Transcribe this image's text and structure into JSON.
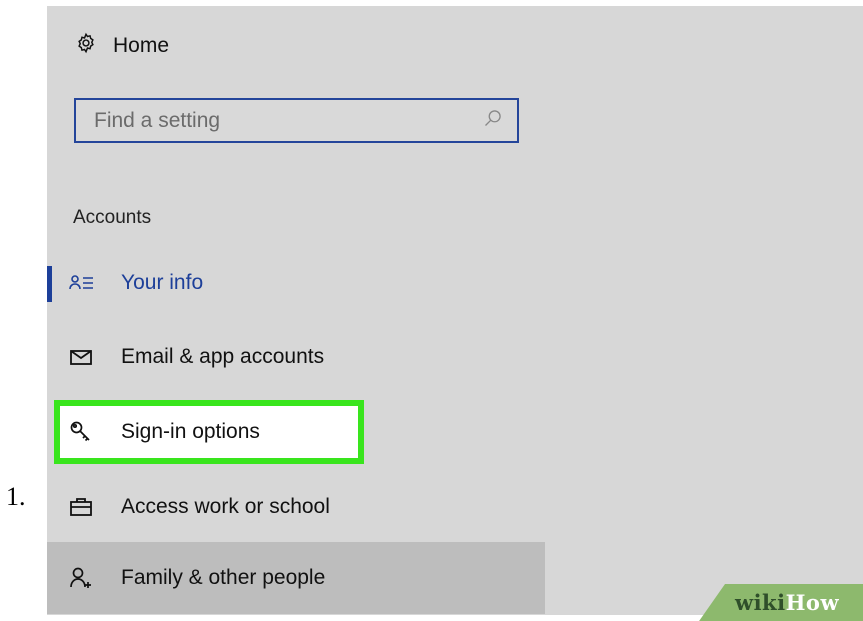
{
  "list_marker": "1.",
  "home": {
    "label": "Home",
    "icon": "gear-icon"
  },
  "search": {
    "placeholder": "Find a setting",
    "value": "",
    "icon": "search-icon"
  },
  "section": {
    "heading": "Accounts"
  },
  "nav": {
    "items": [
      {
        "label": "Your info",
        "icon": "person-list-icon",
        "state": "selected"
      },
      {
        "label": "Email & app accounts",
        "icon": "mail-icon",
        "state": "normal"
      },
      {
        "label": "Sign-in options",
        "icon": "key-icon",
        "state": "highlighted"
      },
      {
        "label": "Access work or school",
        "icon": "briefcase-icon",
        "state": "normal"
      },
      {
        "label": "Family & other people",
        "icon": "add-person-icon",
        "state": "hovered"
      }
    ]
  },
  "watermark": {
    "part1": "wiki",
    "part2": "How"
  },
  "colors": {
    "accent": "#1d3f99",
    "highlight": "#39e51d",
    "panel_bg": "#d7d7d7",
    "hover_bg": "#bdbdbd",
    "watermark_bg": "#8db96d"
  }
}
